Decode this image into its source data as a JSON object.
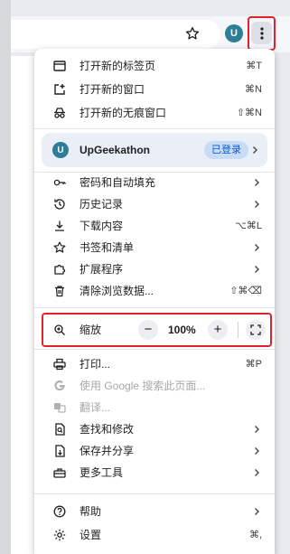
{
  "toolbar": {
    "avatar_letter": "U",
    "star_icon": "star-icon",
    "menu_icon": "kebab-menu-icon"
  },
  "menu": {
    "items_top": [
      {
        "label": "打开新的标签页",
        "shortcut": "⌘T",
        "icon": "new-tab-icon"
      },
      {
        "label": "打开新的窗口",
        "shortcut": "⌘N",
        "icon": "new-window-icon"
      },
      {
        "label": "打开新的无痕窗口",
        "shortcut": "⇧⌘N",
        "icon": "incognito-icon"
      }
    ],
    "profile": {
      "letter": "U",
      "name": "UpGeekathon",
      "badge": "已登录"
    },
    "items_mid": [
      {
        "label": "密码和自动填充",
        "icon": "key-icon"
      },
      {
        "label": "历史记录",
        "icon": "history-icon"
      },
      {
        "label": "下载内容",
        "shortcut": "⌥⌘L",
        "icon": "download-icon"
      },
      {
        "label": "书签和清单",
        "icon": "star-outline-icon"
      },
      {
        "label": "扩展程序",
        "icon": "puzzle-icon"
      },
      {
        "label": "清除浏览数据...",
        "shortcut": "⇧⌘⌫",
        "icon": "trash-icon"
      }
    ],
    "zoom": {
      "label": "缩放",
      "minus": "−",
      "value": "100%",
      "plus": "+"
    },
    "items_tools": [
      {
        "label": "打印...",
        "shortcut": "⌘P",
        "icon": "print-icon"
      },
      {
        "label": "使用 Google 搜索此页面...",
        "icon": "google-icon",
        "disabled": true
      },
      {
        "label": "翻译...",
        "icon": "translate-icon",
        "disabled": true
      },
      {
        "label": "查找和修改",
        "icon": "find-icon"
      },
      {
        "label": "保存并分享",
        "icon": "save-share-icon"
      },
      {
        "label": "更多工具",
        "icon": "toolbox-icon"
      }
    ],
    "items_bottom": [
      {
        "label": "帮助",
        "icon": "help-icon"
      },
      {
        "label": "设置",
        "shortcut": "⌘,",
        "icon": "gear-icon"
      }
    ]
  },
  "colors": {
    "highlight": "#e0232b",
    "badge_text": "#0b57d0",
    "avatar": "#2d7e96"
  }
}
